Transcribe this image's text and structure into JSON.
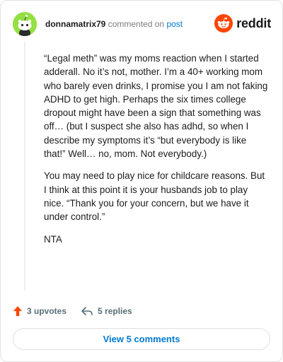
{
  "header": {
    "username": "donnamatrix79",
    "commented_on": "commented on",
    "post_link": "post",
    "brand": "reddit"
  },
  "comment": {
    "paragraphs": [
      "“Legal meth” was my moms reaction when I started adderall. No it’s not, mother. I’m a 40+ working mom who barely even drinks, I promise you I am not faking ADHD to get high. Perhaps the six times college dropout might have been a sign that something was off… (but I suspect she also has adhd, so when I describe my symptoms it’s “but everybody is like that!” Well… no, mom. Not everybody.)",
      "You may need to play nice for childcare reasons. But I think at this point it is your husbands job to play nice. “Thank you for your concern, but we have it under control.”",
      "NTA"
    ]
  },
  "actions": {
    "upvotes": "3 upvotes",
    "replies": "5 replies",
    "view_button": "View 5 comments"
  },
  "colors": {
    "upvote": "#ff4500",
    "link": "#0079d3",
    "avatar_bg": "#94e044",
    "brand_orange": "#ff4500"
  },
  "icons": [
    "snoo-avatar-icon",
    "reddit-logo-icon",
    "upvote-arrow-icon",
    "reply-arrow-icon"
  ]
}
